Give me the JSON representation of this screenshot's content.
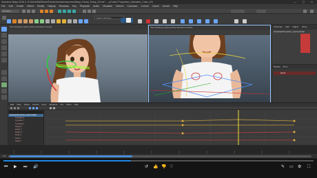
{
  "window": {
    "title": "Autodesk Maya 2018.3: D:\\Work\\SkillShare\\Facial Animation\\scenes\\Maya_Facial_Setup_02.ma*  ---  pCube1 Proportion_Animated_Cube_v01",
    "controls": "—  ▢  ✕"
  },
  "menubar": [
    "File",
    "Edit",
    "Create",
    "Select",
    "Modify",
    "Display",
    "Windows",
    "Key",
    "Playback",
    "Audio",
    "Visualize",
    "Deform",
    "Constrain",
    "Control",
    "Cache",
    "Arnold",
    "Help"
  ],
  "statusline": {
    "mode": "Animation",
    "colors": {
      "orange": "#d9822b",
      "teal": "#3aa6a0",
      "red": "#c33",
      "blue": "#4a8ed8"
    }
  },
  "shelf": {
    "search_placeholder": "Search Shelves..."
  },
  "viewports": {
    "left": {
      "menu": "View  Shading  Lighting  Show  Renderer  Panels"
    },
    "right": {
      "menu": "View  Shading  Lighting  Show  Renderer  Panels"
    }
  },
  "channelbox": {
    "tabs": [
      "Channels",
      "Edit",
      "Object",
      "Show"
    ],
    "object_name": "characterProportion_LipController"
  },
  "layers": {
    "tabs": [
      "Display",
      "Anim"
    ],
    "row_label": "layer1"
  },
  "graph_editor": {
    "menu": [
      "Edit",
      "View",
      "Select",
      "Curves",
      "Keys",
      "Tangents",
      "List",
      "Show",
      "Help"
    ],
    "outliner_selected": "characterProportion_LipController",
    "outliner_items": [
      "Translate X",
      "Translate Y",
      "Translate Z",
      "Rotate X",
      "Rotate Y",
      "Rotate Z",
      "Scale X",
      "Scale Y",
      "Scale Z"
    ]
  },
  "timeline": {
    "start_label": "1.00"
  },
  "player": {
    "progress": 0.41,
    "left_controls": [
      "prev",
      "play",
      "next",
      "volume"
    ],
    "center_controls": [
      "rewind-10",
      "like",
      "dislike",
      "heart"
    ],
    "right_controls": [
      "pencil",
      "captions",
      "settings",
      "fullscreen"
    ]
  },
  "icons": {
    "app": "M"
  }
}
